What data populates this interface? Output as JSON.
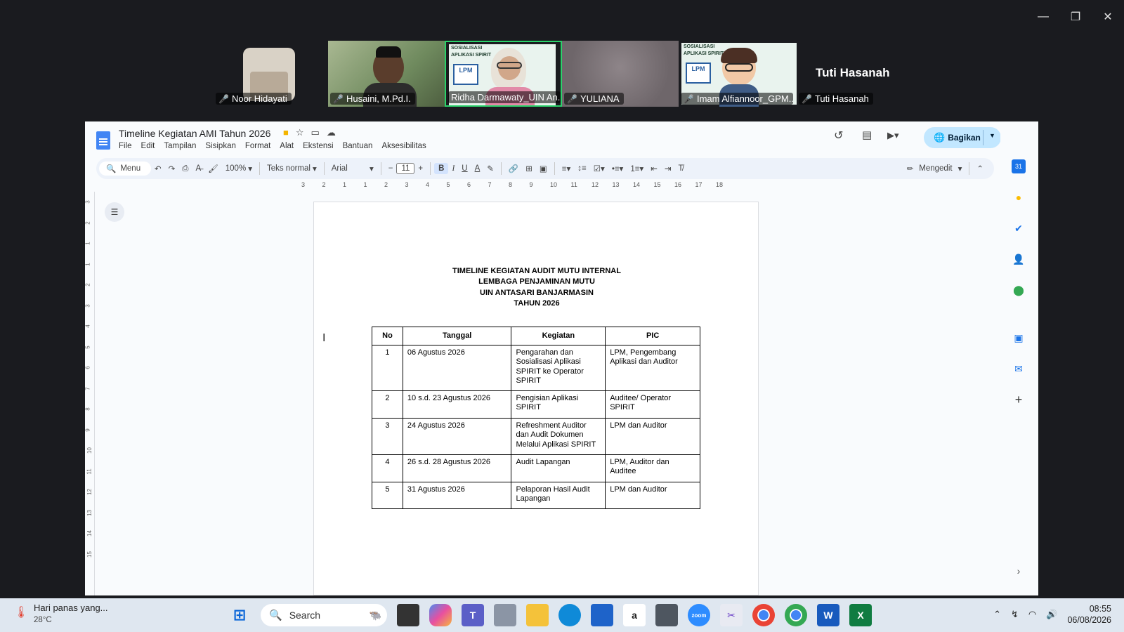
{
  "window_controls": {
    "minimize": "—",
    "restore": "❐",
    "close": "✕"
  },
  "participants": [
    {
      "name": "Noor Hidayati"
    },
    {
      "name": "Husaini, M.Pd.I."
    },
    {
      "name": "Ridha Darmawaty_UIN An..."
    },
    {
      "name": "YULIANA"
    },
    {
      "name": "Imam Alfiannoor_GPM..."
    },
    {
      "name": "Tuti Hasanah"
    }
  ],
  "active_speaker_big_name": "Tuti Hasanah",
  "slide_mini": {
    "title": "SOSIALISASI",
    "subtitle": "APLIKASI SPIRIT",
    "logo": "LPM"
  },
  "doc": {
    "title": "Timeline Kegiatan AMI Tahun 2026",
    "menu": [
      "File",
      "Edit",
      "Tampilan",
      "Sisipkan",
      "Format",
      "Alat",
      "Ekstensi",
      "Bantuan",
      "Aksesibilitas"
    ],
    "share_label": "Bagikan",
    "toolbar": {
      "menu_search": "Menu",
      "zoom": "100%",
      "style": "Teks normal",
      "font": "Arial",
      "font_size": "11",
      "mode": "Mengedit"
    },
    "ruler_numbers": [
      "3",
      "2",
      "1",
      "1",
      "2",
      "3",
      "4",
      "5",
      "6",
      "7",
      "8",
      "9",
      "10",
      "11",
      "12",
      "13",
      "14",
      "15",
      "16",
      "17",
      "18"
    ],
    "vruler_numbers": [
      "3",
      "2",
      "1",
      "1",
      "2",
      "3",
      "4",
      "5",
      "6",
      "7",
      "8",
      "9",
      "10",
      "11",
      "12",
      "13",
      "14",
      "15"
    ],
    "heading": [
      "TIMELINE KEGIATAN AUDIT MUTU INTERNAL",
      "LEMBAGA PENJAMINAN MUTU",
      "UIN ANTASARI BANJARMASIN",
      "TAHUN 2026"
    ],
    "table": {
      "headers": [
        "No",
        "Tanggal",
        "Kegiatan",
        "PIC"
      ],
      "rows": [
        {
          "no": "1",
          "tanggal": "06 Agustus 2026",
          "kegiatan": "Pengarahan dan Sosialisasi Aplikasi SPIRIT ke Operator SPIRIT",
          "pic": "LPM, Pengembang Aplikasi dan Auditor"
        },
        {
          "no": "2",
          "tanggal": "10 s.d. 23 Agustus 2026",
          "kegiatan": "Pengisian Aplikasi SPIRIT",
          "pic": "Auditee/ Operator SPIRIT"
        },
        {
          "no": "3",
          "tanggal": "24 Agustus 2026",
          "kegiatan": "Refreshment Auditor dan Audit Dokumen Melalui Aplikasi SPIRIT",
          "pic": "LPM dan Auditor"
        },
        {
          "no": "4",
          "tanggal": "26 s.d. 28 Agustus 2026",
          "kegiatan": "Audit Lapangan",
          "pic": "LPM, Auditor dan Auditee"
        },
        {
          "no": "5",
          "tanggal": "31 Agustus 2026",
          "kegiatan": "Pelaporan Hasil Audit Lapangan",
          "pic": "LPM dan Auditor"
        }
      ]
    }
  },
  "taskbar": {
    "weather_text": "Hari panas yang...",
    "temperature": "28°C",
    "search_label": "Search",
    "time": "08:55",
    "date": "06/08/2026"
  }
}
